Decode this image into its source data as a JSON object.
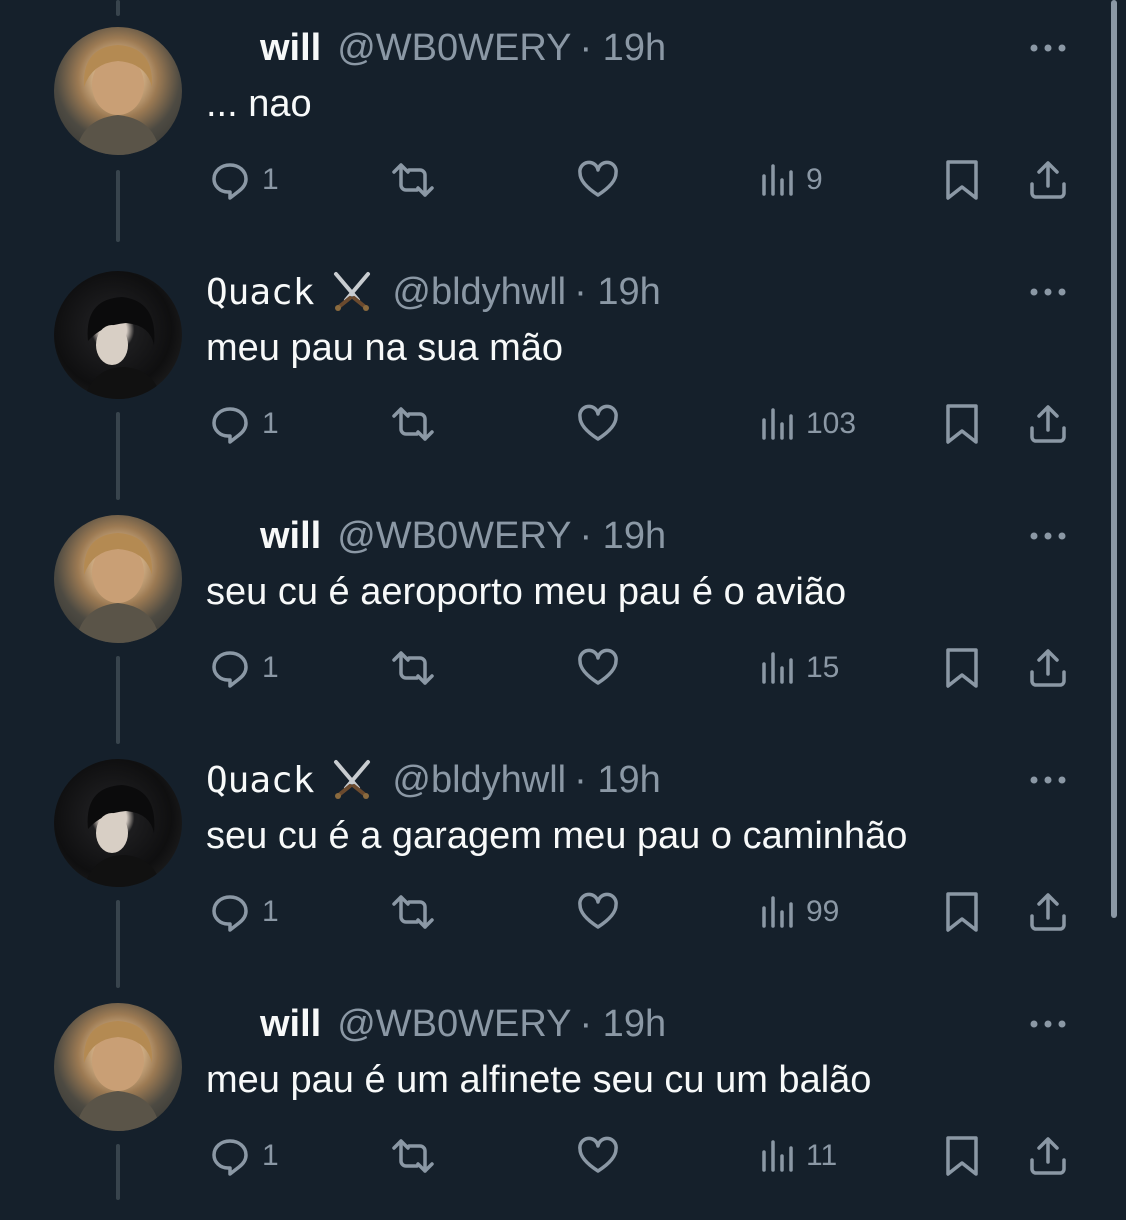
{
  "tweets": [
    {
      "name": "will",
      "handle": "@WB0WERY",
      "time": "· 19h",
      "text": "... nao",
      "replies": "1",
      "views": "9",
      "avatar": "will-avatar"
    },
    {
      "name": "Quack",
      "badge_icon": "crossed-swords-icon",
      "handle": "@bldyhwll",
      "time": "· 19h",
      "text": "meu pau na sua mão",
      "replies": "1",
      "views": "103",
      "avatar": "quack-avatar"
    },
    {
      "name": "will",
      "handle": "@WB0WERY",
      "time": "· 19h",
      "text": "seu cu é aeroporto meu pau é o avião",
      "replies": "1",
      "views": "15",
      "avatar": "will-avatar"
    },
    {
      "name": "Quack",
      "badge_icon": "crossed-swords-icon",
      "handle": "@bldyhwll",
      "time": "· 19h",
      "text": "seu cu é a garagem meu pau o caminhão",
      "replies": "1",
      "views": "99",
      "avatar": "quack-avatar"
    },
    {
      "name": "will",
      "handle": "@WB0WERY",
      "time": "· 19h",
      "text": "meu pau é um alfinete seu cu um balão",
      "replies": "1",
      "views": "11",
      "avatar": "will-avatar"
    }
  ],
  "colors": {
    "background": "#15202b",
    "text": "#f7f9f9",
    "muted": "#8b98a5",
    "thread_line": "#38444d"
  }
}
